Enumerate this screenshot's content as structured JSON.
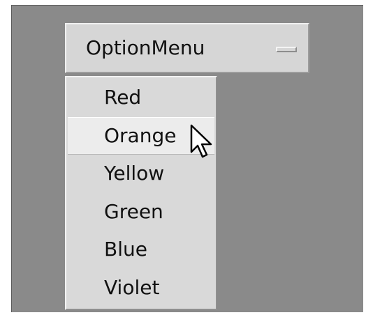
{
  "optionmenu": {
    "label": "OptionMenu",
    "indicator_icon": "option-indicator-icon"
  },
  "menu": {
    "items": [
      {
        "label": "Red"
      },
      {
        "label": "Orange"
      },
      {
        "label": "Yellow"
      },
      {
        "label": "Green"
      },
      {
        "label": "Blue"
      },
      {
        "label": "Violet"
      }
    ],
    "active_index": 1
  },
  "cursor": {
    "icon": "arrow-cursor-icon"
  },
  "colors": {
    "background": "#8a8a8a",
    "widget": "#d6d6d6",
    "highlight": "#ececec",
    "text": "#111111"
  }
}
